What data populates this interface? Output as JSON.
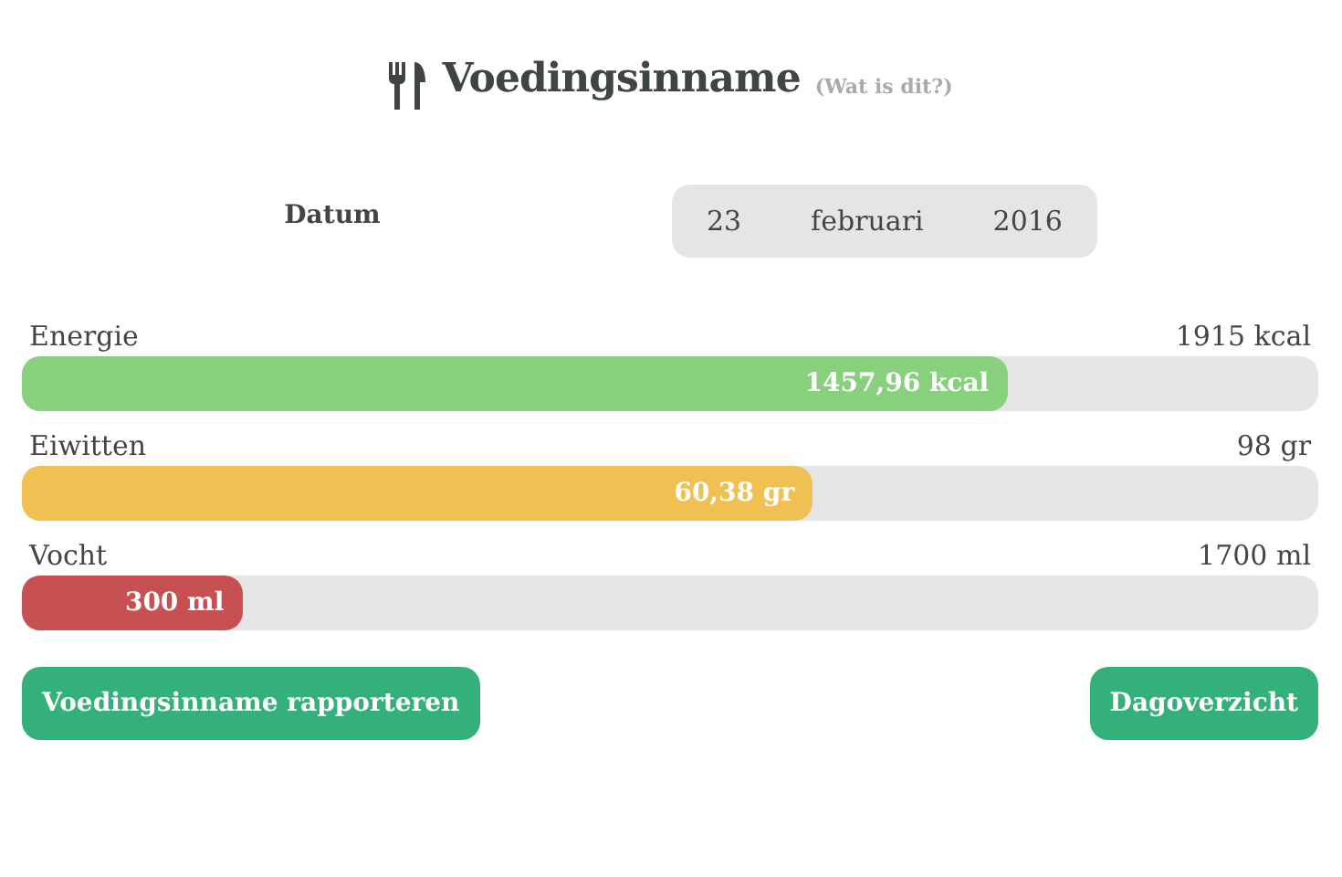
{
  "title": "Voedingsinname",
  "help_link": "(Wat is dit?)",
  "date": {
    "label": "Datum",
    "day": "23",
    "month": "februari",
    "year": "2016"
  },
  "meters": [
    {
      "name": "Energie",
      "target": "1915 kcal",
      "reading": "1457,96 kcal",
      "level": 0.76,
      "color": "#88cf7e"
    },
    {
      "name": "Eiwitten",
      "target": "98 gr",
      "reading": "60,38 gr",
      "level": 0.61,
      "color": "#f0c152"
    },
    {
      "name": "Vocht",
      "target": "1700 ml",
      "reading": "300 ml",
      "level": 0.17,
      "color": "#c65052"
    }
  ],
  "buttons": [
    "Voedingsinname rapporteren",
    "Dagoverzicht"
  ]
}
